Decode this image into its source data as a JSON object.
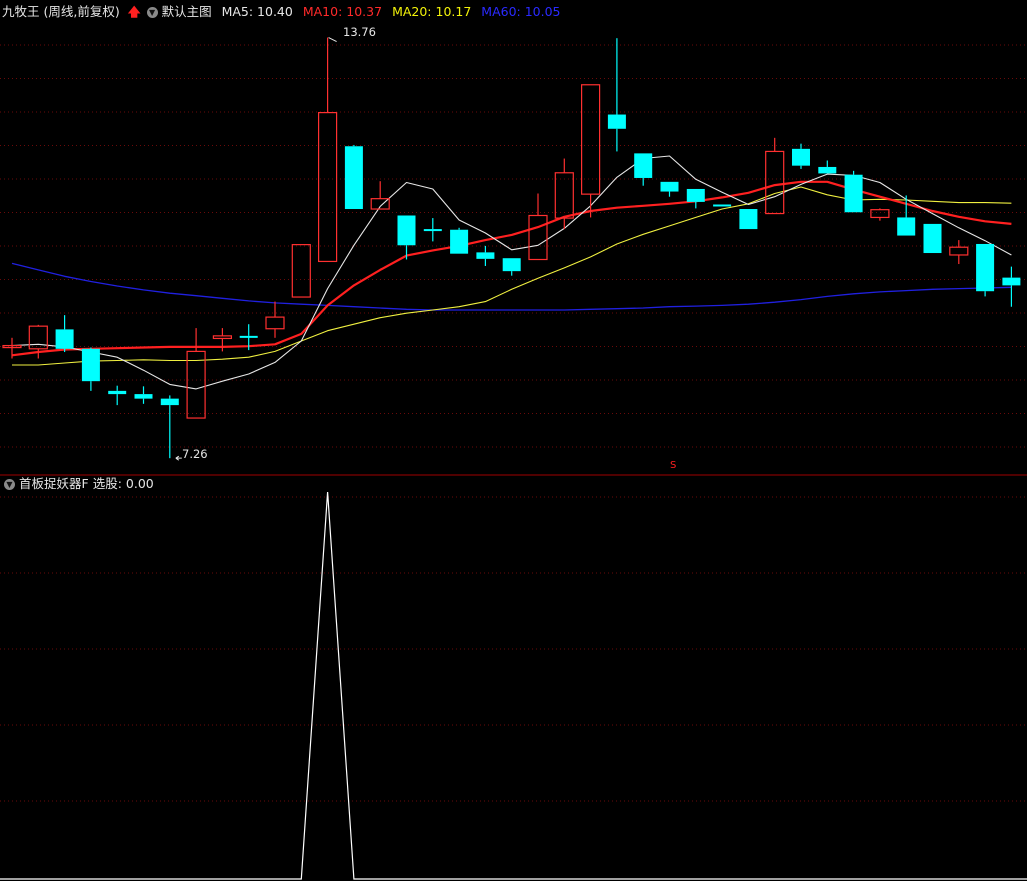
{
  "header": {
    "title": "九牧王 (周线,前复权)",
    "main_label": "默认主图",
    "ma": [
      {
        "label": "MA5: 10.40",
        "color": "#e6e6e6"
      },
      {
        "label": "MA10: 10.37",
        "color": "#ff2a2a"
      },
      {
        "label": "MA20: 10.17",
        "color": "#f2f20a"
      },
      {
        "label": "MA60: 10.05",
        "color": "#2a2aff"
      }
    ]
  },
  "annotations": {
    "high": "13.76",
    "low": "7.26",
    "signal": "S"
  },
  "indicator": {
    "title": "首板捉妖器F",
    "value_label": "选股: 0.00"
  },
  "colors": {
    "up": "#ff3030",
    "down": "#00ffff",
    "ma5": "#e6e6e6",
    "ma10": "#ff2020",
    "ma20": "#f0f040",
    "ma60": "#2020e0",
    "grid": "#6a0a0a",
    "divider": "#a00000",
    "signal_line": "#ffffff"
  },
  "chart_data": {
    "type": "candlestick",
    "price_range": [
      7.0,
      14.0
    ],
    "candles": [
      {
        "o": 9.0,
        "c": 9.0,
        "h": 9.12,
        "l": 8.8
      },
      {
        "o": 8.95,
        "c": 9.3,
        "h": 9.32,
        "l": 8.8
      },
      {
        "o": 9.25,
        "c": 8.95,
        "h": 9.47,
        "l": 8.9
      },
      {
        "o": 8.95,
        "c": 8.45,
        "h": 8.97,
        "l": 8.3
      },
      {
        "o": 8.3,
        "c": 8.25,
        "h": 8.38,
        "l": 8.08
      },
      {
        "o": 8.25,
        "c": 8.18,
        "h": 8.37,
        "l": 8.1
      },
      {
        "o": 8.18,
        "c": 8.08,
        "h": 8.23,
        "l": 7.26
      },
      {
        "o": 7.88,
        "c": 8.91,
        "h": 9.27,
        "l": 7.88
      },
      {
        "o": 9.11,
        "c": 9.15,
        "h": 9.27,
        "l": 8.91
      },
      {
        "o": 9.15,
        "c": 9.14,
        "h": 9.33,
        "l": 8.93
      },
      {
        "o": 9.26,
        "c": 9.44,
        "h": 9.68,
        "l": 9.12
      },
      {
        "o": 9.75,
        "c": 10.56,
        "h": 10.56,
        "l": 9.75
      },
      {
        "o": 10.3,
        "c": 12.6,
        "h": 13.76,
        "l": 10.3
      },
      {
        "o": 12.08,
        "c": 11.11,
        "h": 12.1,
        "l": 11.11
      },
      {
        "o": 11.11,
        "c": 11.27,
        "h": 11.54,
        "l": 11.11
      },
      {
        "o": 11.01,
        "c": 10.55,
        "h": 11.01,
        "l": 10.33
      },
      {
        "o": 10.8,
        "c": 10.78,
        "h": 10.97,
        "l": 10.61
      },
      {
        "o": 10.79,
        "c": 10.42,
        "h": 10.82,
        "l": 10.42
      },
      {
        "o": 10.44,
        "c": 10.34,
        "h": 10.54,
        "l": 10.23
      },
      {
        "o": 10.35,
        "c": 10.15,
        "h": 10.35,
        "l": 10.08
      },
      {
        "o": 10.33,
        "c": 11.01,
        "h": 11.35,
        "l": 10.33
      },
      {
        "o": 10.97,
        "c": 11.67,
        "h": 11.89,
        "l": 10.8
      },
      {
        "o": 11.34,
        "c": 13.03,
        "h": 13.03,
        "l": 10.98
      },
      {
        "o": 12.57,
        "c": 12.35,
        "h": 13.75,
        "l": 12.0
      },
      {
        "o": 11.97,
        "c": 11.59,
        "h": 11.97,
        "l": 11.47
      },
      {
        "o": 11.53,
        "c": 11.38,
        "h": 11.53,
        "l": 11.3
      },
      {
        "o": 11.42,
        "c": 11.22,
        "h": 11.42,
        "l": 11.12
      },
      {
        "o": 11.18,
        "c": 11.16,
        "h": 11.18,
        "l": 11.16
      },
      {
        "o": 11.11,
        "c": 10.8,
        "h": 11.11,
        "l": 10.8
      },
      {
        "o": 11.04,
        "c": 12.0,
        "h": 12.21,
        "l": 11.04
      },
      {
        "o": 12.04,
        "c": 11.78,
        "h": 12.12,
        "l": 11.73
      },
      {
        "o": 11.76,
        "c": 11.66,
        "h": 11.86,
        "l": 11.66
      },
      {
        "o": 11.64,
        "c": 11.06,
        "h": 11.7,
        "l": 11.06
      },
      {
        "o": 10.98,
        "c": 11.1,
        "h": 11.12,
        "l": 10.93
      },
      {
        "o": 10.98,
        "c": 10.7,
        "h": 11.32,
        "l": 10.7
      },
      {
        "o": 10.88,
        "c": 10.43,
        "h": 10.88,
        "l": 10.43
      },
      {
        "o": 10.4,
        "c": 10.52,
        "h": 10.63,
        "l": 10.26
      },
      {
        "o": 10.57,
        "c": 9.84,
        "h": 10.57,
        "l": 9.76
      },
      {
        "o": 10.05,
        "c": 9.93,
        "h": 10.22,
        "l": 9.6
      }
    ],
    "ma5": [
      9.0,
      9.02,
      8.98,
      8.9,
      8.82,
      8.62,
      8.4,
      8.33,
      8.45,
      8.56,
      8.74,
      9.07,
      9.88,
      10.55,
      11.15,
      11.52,
      11.42,
      10.94,
      10.74,
      10.48,
      10.55,
      10.81,
      11.16,
      11.6,
      11.89,
      11.93,
      11.57,
      11.37,
      11.18,
      11.3,
      11.49,
      11.65,
      11.63,
      11.52,
      11.26,
      11.04,
      10.82,
      10.62,
      10.4
    ],
    "ma10": [
      8.85,
      8.9,
      8.94,
      8.95,
      8.96,
      8.97,
      8.98,
      8.98,
      8.98,
      8.99,
      9.02,
      9.18,
      9.62,
      9.93,
      10.17,
      10.39,
      10.47,
      10.54,
      10.63,
      10.71,
      10.83,
      10.99,
      11.08,
      11.13,
      11.16,
      11.19,
      11.23,
      11.29,
      11.36,
      11.48,
      11.53,
      11.53,
      11.41,
      11.3,
      11.19,
      11.08,
      10.99,
      10.92,
      10.88
    ],
    "ma20": [
      8.7,
      8.7,
      8.73,
      8.76,
      8.77,
      8.78,
      8.77,
      8.77,
      8.79,
      8.82,
      8.91,
      9.07,
      9.23,
      9.33,
      9.43,
      9.5,
      9.55,
      9.6,
      9.68,
      9.87,
      10.04,
      10.2,
      10.37,
      10.57,
      10.72,
      10.85,
      10.98,
      11.11,
      11.19,
      11.35,
      11.45,
      11.33,
      11.25,
      11.26,
      11.25,
      11.23,
      11.21,
      11.21,
      11.2
    ],
    "ma60": [
      10.27,
      10.17,
      10.07,
      9.99,
      9.92,
      9.86,
      9.81,
      9.77,
      9.73,
      9.69,
      9.66,
      9.64,
      9.62,
      9.6,
      9.58,
      9.56,
      9.55,
      9.55,
      9.55,
      9.55,
      9.55,
      9.55,
      9.56,
      9.57,
      9.58,
      9.6,
      9.61,
      9.62,
      9.64,
      9.67,
      9.71,
      9.76,
      9.8,
      9.83,
      9.85,
      9.87,
      9.88,
      9.89,
      9.9
    ],
    "signal": [
      0,
      0,
      0,
      0,
      0,
      0,
      0,
      0,
      0,
      0,
      0,
      0,
      1,
      0,
      0,
      0,
      0,
      0,
      0,
      0,
      0,
      0,
      0,
      0,
      0,
      0,
      0,
      0,
      0,
      0,
      0,
      0,
      0,
      0,
      0,
      0,
      0,
      0,
      0
    ],
    "signal_range": [
      0,
      1
    ]
  }
}
